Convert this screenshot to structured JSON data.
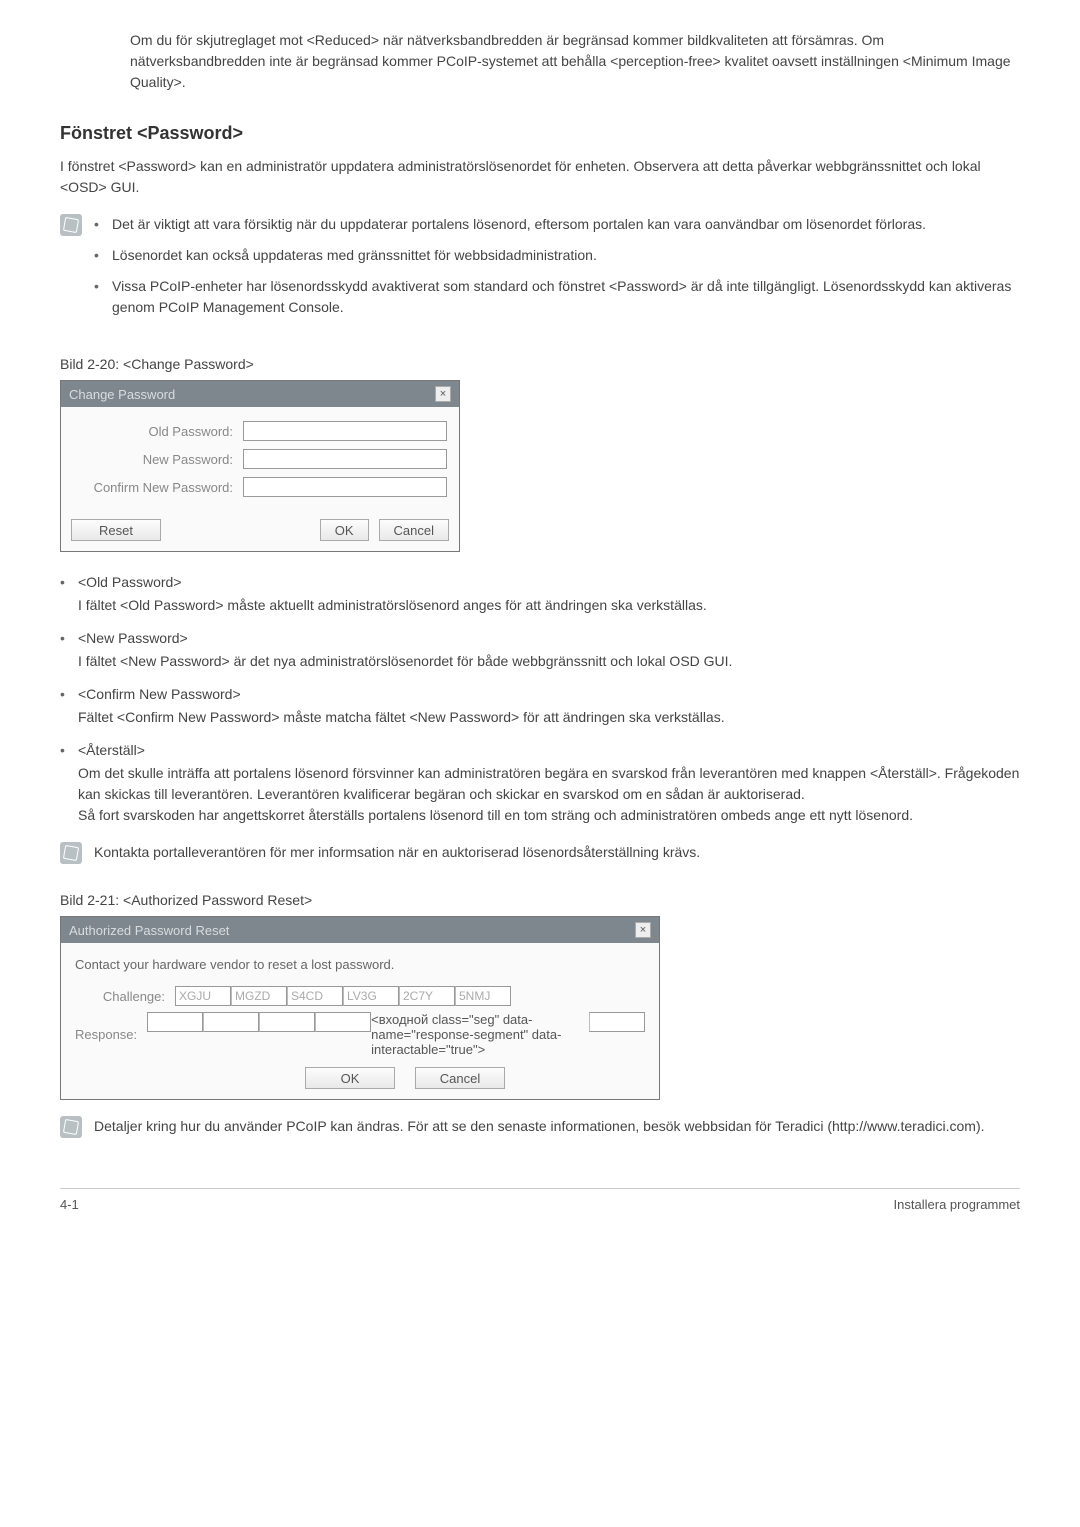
{
  "intro_para": "Om du för skjutreglaget mot <Reduced> när nätverksbandbredden är begränsad kommer bildkvaliteten att försämras. Om nätverksbandbredden inte är begränsad kommer PCoIP-systemet att behålla <perception-free> kvalitet oavsett inställningen <Minimum Image Quality>.",
  "section": {
    "title": "Fönstret <Password>",
    "desc": "I fönstret <Password> kan en administratör uppdatera administratörslösenordet för enheten. Observera att detta påverkar webbgränssnittet och lokal <OSD> GUI.",
    "note_bullets": [
      "Det är viktigt att vara försiktig när du uppdaterar portalens lösenord, eftersom portalen kan vara oanvändbar om lösenordet förloras.",
      "Lösenordet kan också uppdateras med gränssnittet för webbsidadministration.",
      "Vissa PCoIP-enheter har lösenordsskydd avaktiverat som standard och fönstret <Password> är då inte tillgängligt. Lösenordsskydd kan aktiveras genom PCoIP Management Console."
    ]
  },
  "figure1": {
    "caption": "Bild 2-20: <Change Password>",
    "title": "Change Password",
    "labels": {
      "old": "Old Password:",
      "new": "New Password:",
      "confirm": "Confirm New Password:"
    },
    "buttons": {
      "reset": "Reset",
      "ok": "OK",
      "cancel": "Cancel"
    }
  },
  "defs": [
    {
      "term": "<Old Password>",
      "desc": "I fältet <Old Password> måste aktuellt administratörslösenord anges för att ändringen ska verkställas."
    },
    {
      "term": "<New Password>",
      "desc": "I fältet <New Password> är det nya administratörslösenordet för både webbgränssnitt och lokal OSD GUI."
    },
    {
      "term": "<Confirm New Password>",
      "desc": "Fältet <Confirm New Password> måste matcha fältet <New Password> för att ändringen ska verkställas."
    },
    {
      "term": "<Återställ>",
      "desc": "Om det skulle inträffa att portalens lösenord försvinner kan administratören begära en svarskod från leverantören med knappen <Återställ>. Frågekoden kan skickas till leverantören. Leverantören kvalificerar begäran och skickar en svarskod om en sådan är auktoriserad.\nSå fort svarskoden har angettskorret återställs portalens lösenord till en tom sträng och administratören ombeds ange ett nytt lösenord."
    }
  ],
  "note2": "Kontakta portalleverantören för mer informsation när en auktoriserad lösenordsåterställning krävs.",
  "figure2": {
    "caption": "Bild 2-21: <Authorized Password Reset>",
    "title": "Authorized Password Reset",
    "message": "Contact your hardware vendor to reset a lost password.",
    "labels": {
      "challenge": "Challenge:",
      "response": "Response:"
    },
    "challenge": [
      "XGJU",
      "MGZD",
      "S4CD",
      "LV3G",
      "2C7Y",
      "5NMJ"
    ],
    "buttons": {
      "ok": "OK",
      "cancel": "Cancel"
    }
  },
  "note3": "Detaljer kring hur du använder PCoIP kan ändras. För att se den senaste informationen, besök webbsidan för Teradici (http://www.teradici.com).",
  "footer": {
    "left": "4-1",
    "right": "Installera programmet"
  }
}
